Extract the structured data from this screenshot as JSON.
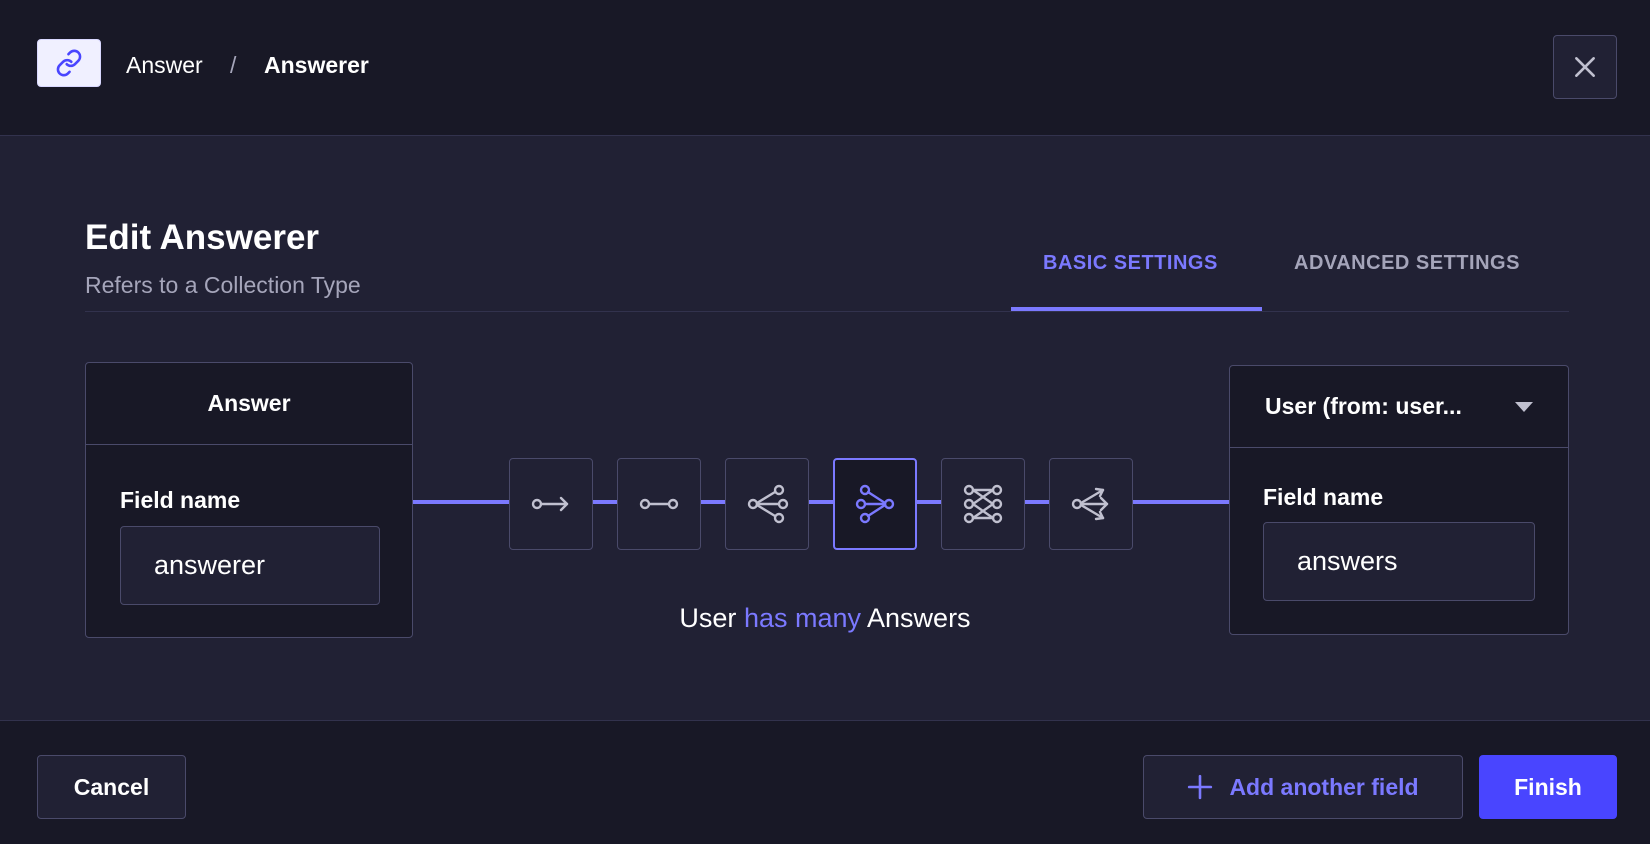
{
  "header": {
    "icon": "link-icon",
    "breadcrumb_parent": "Answer",
    "breadcrumb_separator": "/",
    "breadcrumb_current": "Answerer",
    "close_icon": "close-icon"
  },
  "title": "Edit Answerer",
  "subtitle": "Refers to a Collection Type",
  "tabs": [
    {
      "label": "BASIC SETTINGS",
      "active": true
    },
    {
      "label": "ADVANCED SETTINGS",
      "active": false
    }
  ],
  "left_box": {
    "title": "Answer",
    "field_label": "Field name",
    "field_value": "answerer"
  },
  "right_box": {
    "selected": "User (from: user...",
    "field_label": "Field name",
    "field_value": "answers"
  },
  "relations": [
    {
      "icon": "one-way-icon",
      "active": false
    },
    {
      "icon": "one-to-one-icon",
      "active": false
    },
    {
      "icon": "one-to-many-icon",
      "active": false
    },
    {
      "icon": "many-to-one-icon",
      "active": true
    },
    {
      "icon": "many-to-many-icon",
      "active": false
    },
    {
      "icon": "many-way-icon",
      "active": false
    }
  ],
  "relation_sentence": {
    "left": "User",
    "middle": "has many",
    "right": "Answers"
  },
  "footer": {
    "cancel_label": "Cancel",
    "add_label": "Add another field",
    "finish_label": "Finish"
  },
  "colors": {
    "accent": "#7b79ff",
    "primary_button": "#4945ff",
    "background": "#212134",
    "surface": "#181826"
  }
}
